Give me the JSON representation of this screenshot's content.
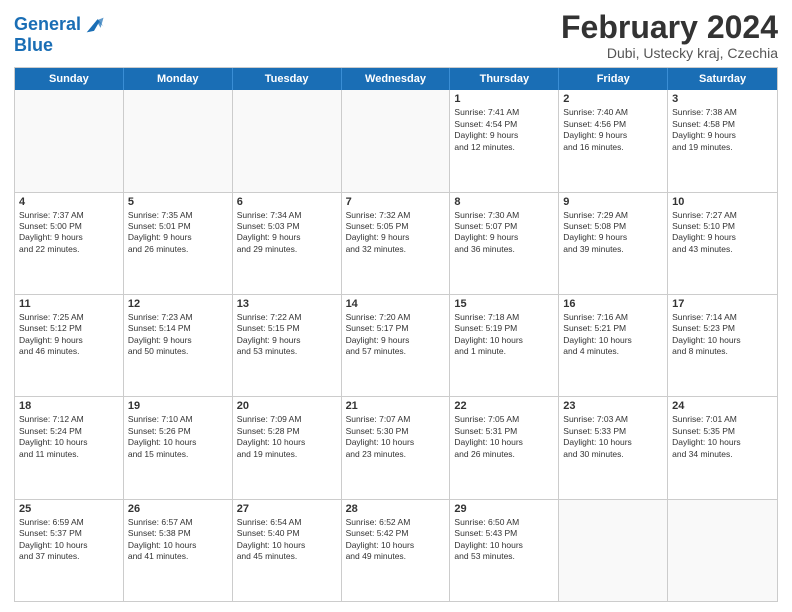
{
  "logo": {
    "line1": "General",
    "line2": "Blue"
  },
  "title": "February 2024",
  "subtitle": "Dubi, Ustecky kraj, Czechia",
  "headers": [
    "Sunday",
    "Monday",
    "Tuesday",
    "Wednesday",
    "Thursday",
    "Friday",
    "Saturday"
  ],
  "rows": [
    [
      {
        "day": "",
        "info": ""
      },
      {
        "day": "",
        "info": ""
      },
      {
        "day": "",
        "info": ""
      },
      {
        "day": "",
        "info": ""
      },
      {
        "day": "1",
        "info": "Sunrise: 7:41 AM\nSunset: 4:54 PM\nDaylight: 9 hours\nand 12 minutes."
      },
      {
        "day": "2",
        "info": "Sunrise: 7:40 AM\nSunset: 4:56 PM\nDaylight: 9 hours\nand 16 minutes."
      },
      {
        "day": "3",
        "info": "Sunrise: 7:38 AM\nSunset: 4:58 PM\nDaylight: 9 hours\nand 19 minutes."
      }
    ],
    [
      {
        "day": "4",
        "info": "Sunrise: 7:37 AM\nSunset: 5:00 PM\nDaylight: 9 hours\nand 22 minutes."
      },
      {
        "day": "5",
        "info": "Sunrise: 7:35 AM\nSunset: 5:01 PM\nDaylight: 9 hours\nand 26 minutes."
      },
      {
        "day": "6",
        "info": "Sunrise: 7:34 AM\nSunset: 5:03 PM\nDaylight: 9 hours\nand 29 minutes."
      },
      {
        "day": "7",
        "info": "Sunrise: 7:32 AM\nSunset: 5:05 PM\nDaylight: 9 hours\nand 32 minutes."
      },
      {
        "day": "8",
        "info": "Sunrise: 7:30 AM\nSunset: 5:07 PM\nDaylight: 9 hours\nand 36 minutes."
      },
      {
        "day": "9",
        "info": "Sunrise: 7:29 AM\nSunset: 5:08 PM\nDaylight: 9 hours\nand 39 minutes."
      },
      {
        "day": "10",
        "info": "Sunrise: 7:27 AM\nSunset: 5:10 PM\nDaylight: 9 hours\nand 43 minutes."
      }
    ],
    [
      {
        "day": "11",
        "info": "Sunrise: 7:25 AM\nSunset: 5:12 PM\nDaylight: 9 hours\nand 46 minutes."
      },
      {
        "day": "12",
        "info": "Sunrise: 7:23 AM\nSunset: 5:14 PM\nDaylight: 9 hours\nand 50 minutes."
      },
      {
        "day": "13",
        "info": "Sunrise: 7:22 AM\nSunset: 5:15 PM\nDaylight: 9 hours\nand 53 minutes."
      },
      {
        "day": "14",
        "info": "Sunrise: 7:20 AM\nSunset: 5:17 PM\nDaylight: 9 hours\nand 57 minutes."
      },
      {
        "day": "15",
        "info": "Sunrise: 7:18 AM\nSunset: 5:19 PM\nDaylight: 10 hours\nand 1 minute."
      },
      {
        "day": "16",
        "info": "Sunrise: 7:16 AM\nSunset: 5:21 PM\nDaylight: 10 hours\nand 4 minutes."
      },
      {
        "day": "17",
        "info": "Sunrise: 7:14 AM\nSunset: 5:23 PM\nDaylight: 10 hours\nand 8 minutes."
      }
    ],
    [
      {
        "day": "18",
        "info": "Sunrise: 7:12 AM\nSunset: 5:24 PM\nDaylight: 10 hours\nand 11 minutes."
      },
      {
        "day": "19",
        "info": "Sunrise: 7:10 AM\nSunset: 5:26 PM\nDaylight: 10 hours\nand 15 minutes."
      },
      {
        "day": "20",
        "info": "Sunrise: 7:09 AM\nSunset: 5:28 PM\nDaylight: 10 hours\nand 19 minutes."
      },
      {
        "day": "21",
        "info": "Sunrise: 7:07 AM\nSunset: 5:30 PM\nDaylight: 10 hours\nand 23 minutes."
      },
      {
        "day": "22",
        "info": "Sunrise: 7:05 AM\nSunset: 5:31 PM\nDaylight: 10 hours\nand 26 minutes."
      },
      {
        "day": "23",
        "info": "Sunrise: 7:03 AM\nSunset: 5:33 PM\nDaylight: 10 hours\nand 30 minutes."
      },
      {
        "day": "24",
        "info": "Sunrise: 7:01 AM\nSunset: 5:35 PM\nDaylight: 10 hours\nand 34 minutes."
      }
    ],
    [
      {
        "day": "25",
        "info": "Sunrise: 6:59 AM\nSunset: 5:37 PM\nDaylight: 10 hours\nand 37 minutes."
      },
      {
        "day": "26",
        "info": "Sunrise: 6:57 AM\nSunset: 5:38 PM\nDaylight: 10 hours\nand 41 minutes."
      },
      {
        "day": "27",
        "info": "Sunrise: 6:54 AM\nSunset: 5:40 PM\nDaylight: 10 hours\nand 45 minutes."
      },
      {
        "day": "28",
        "info": "Sunrise: 6:52 AM\nSunset: 5:42 PM\nDaylight: 10 hours\nand 49 minutes."
      },
      {
        "day": "29",
        "info": "Sunrise: 6:50 AM\nSunset: 5:43 PM\nDaylight: 10 hours\nand 53 minutes."
      },
      {
        "day": "",
        "info": ""
      },
      {
        "day": "",
        "info": ""
      }
    ]
  ]
}
